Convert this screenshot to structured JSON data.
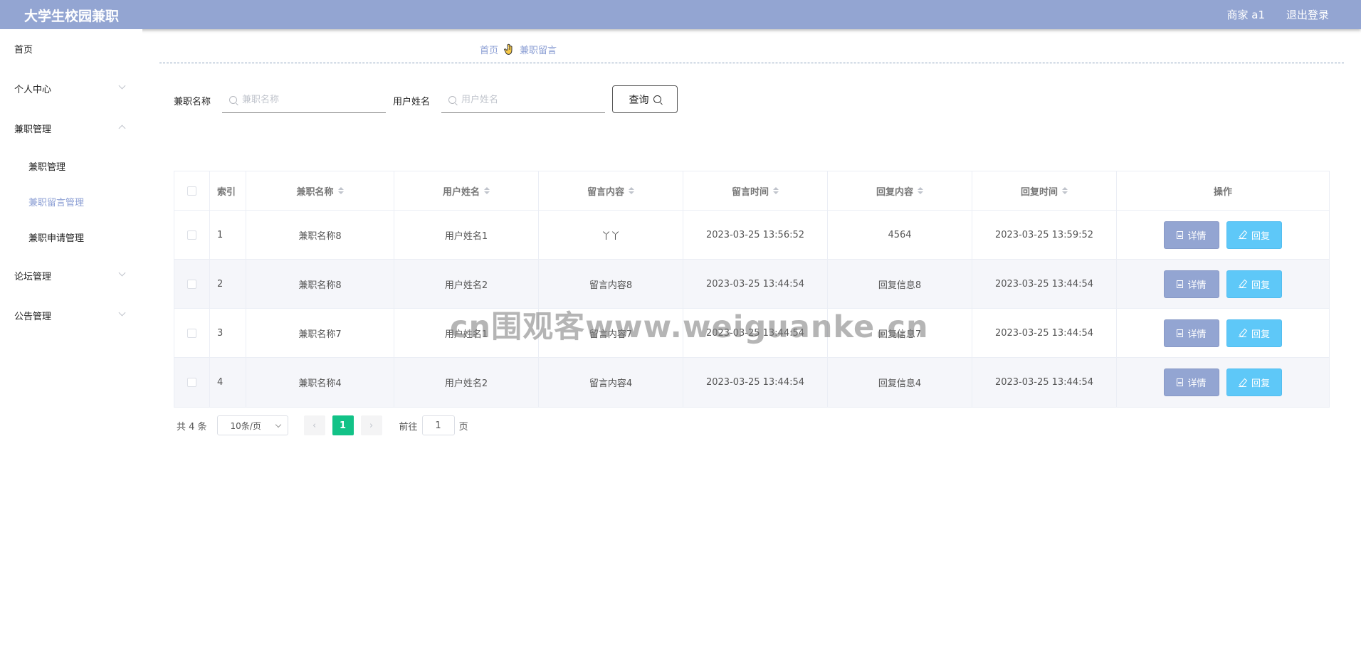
{
  "header": {
    "title": "大学生校园兼职",
    "user": "商家 a1",
    "logout": "退出登录"
  },
  "sidebar": {
    "items": [
      {
        "label": "首页"
      },
      {
        "label": "个人中心"
      },
      {
        "label": "兼职管理"
      },
      {
        "label": "论坛管理"
      },
      {
        "label": "公告管理"
      }
    ],
    "sub_items": [
      {
        "label": "兼职管理"
      },
      {
        "label": "兼职留言管理"
      },
      {
        "label": "兼职申请管理"
      }
    ]
  },
  "breadcrumb": {
    "home": "首页",
    "current": "兼职留言"
  },
  "search": {
    "job_label": "兼职名称",
    "job_placeholder": "兼职名称",
    "user_label": "用户姓名",
    "user_placeholder": "用户姓名",
    "query_label": "查询"
  },
  "table": {
    "headers": [
      "索引",
      "兼职名称",
      "用户姓名",
      "留言内容",
      "留言时间",
      "回复内容",
      "回复时间",
      "操作"
    ],
    "detail_label": "详情",
    "reply_label": "回复",
    "rows": [
      {
        "index": "1",
        "job": "兼职名称8",
        "user": "用户姓名1",
        "message": "丫丫",
        "msg_time": "2023-03-25 13:56:52",
        "reply": "4564",
        "reply_time": "2023-03-25 13:59:52"
      },
      {
        "index": "2",
        "job": "兼职名称8",
        "user": "用户姓名2",
        "message": "留言内容8",
        "msg_time": "2023-03-25 13:44:54",
        "reply": "回复信息8",
        "reply_time": "2023-03-25 13:44:54"
      },
      {
        "index": "3",
        "job": "兼职名称7",
        "user": "用户姓名1",
        "message": "留言内容7",
        "msg_time": "2023-03-25 13:44:54",
        "reply": "回复信息7",
        "reply_time": "2023-03-25 13:44:54"
      },
      {
        "index": "4",
        "job": "兼职名称4",
        "user": "用户姓名2",
        "message": "留言内容4",
        "msg_time": "2023-03-25 13:44:54",
        "reply": "回复信息4",
        "reply_time": "2023-03-25 13:44:54"
      }
    ]
  },
  "pagination": {
    "total": "共 4 条",
    "page_size": "10条/页",
    "current_page": "1",
    "goto_prefix": "前往",
    "goto_value": "1",
    "goto_suffix": "页"
  },
  "watermark": "cn围观客www.weiguanke.cn",
  "colors": {
    "header": "#93a5d2",
    "accent": "#8b9ed4",
    "reply_button": "#5ec8f8",
    "page_active": "#12c287"
  }
}
